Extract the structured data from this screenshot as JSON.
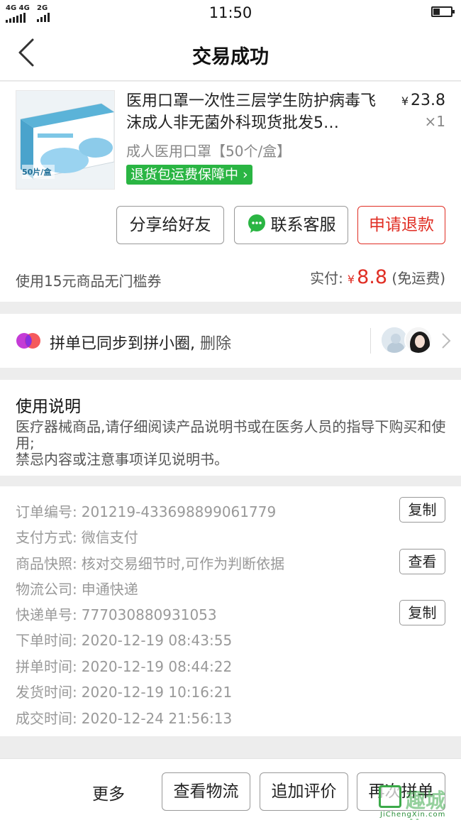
{
  "status_bar": {
    "network_1": "4G 4G",
    "network_2": "2G",
    "time": "11:50"
  },
  "header": {
    "title": "交易成功"
  },
  "product": {
    "name": "医用口罩一次性三层学生防护病毒飞沫成人非无菌外科现货批发5…",
    "price_symbol": "¥",
    "price": "23.8",
    "quantity": "×1",
    "spec": "成人医用口罩【50个/盒】",
    "tag": "退货包运费保障中 ›",
    "thumb_label": "50片/盒",
    "actions": {
      "share": "分享给好友",
      "contact": "联系客服",
      "refund": "申请退款"
    },
    "coupon": "使用15元商品无门槛券",
    "paid_label": "实付:",
    "paid_symbol": "¥",
    "paid_amount": "8.8",
    "paid_note": "(免运费)"
  },
  "sync": {
    "text": "拼单已同步到拼小圈,",
    "delete": "删除"
  },
  "instructions": {
    "title": "使用说明",
    "body": "医疗器械商品,请仔细阅读产品说明书或在医务人员的指导下购买和使用;\n禁忌内容或注意事项详见说明书。"
  },
  "order": {
    "rows": [
      {
        "label": "订单编号:",
        "value": "201219-433698899061779",
        "button": "复制"
      },
      {
        "label": "支付方式:",
        "value": "微信支付"
      },
      {
        "label": "商品快照:",
        "value": "核对交易细节时,可作为判断依据",
        "button": "查看"
      },
      {
        "label": "物流公司:",
        "value": "申通快递"
      },
      {
        "label": "快递单号:",
        "value": "777030880931053",
        "button": "复制"
      },
      {
        "label": "下单时间:",
        "value": "2020-12-19 08:43:55"
      },
      {
        "label": "拼单时间:",
        "value": "2020-12-19 08:44:22"
      },
      {
        "label": "发货时间:",
        "value": "2020-12-19 10:16:21"
      },
      {
        "label": "成交时间:",
        "value": "2020-12-24 21:56:13"
      }
    ]
  },
  "bottom_bar": {
    "more": "更多",
    "logistics": "查看物流",
    "review": "追加评价",
    "reorder": "再次拼单"
  },
  "watermark": {
    "cn": "趣城信",
    "en": "JiChengXin.com"
  },
  "colors": {
    "accent_red": "#e02e24",
    "tag_green": "#2ab543"
  }
}
